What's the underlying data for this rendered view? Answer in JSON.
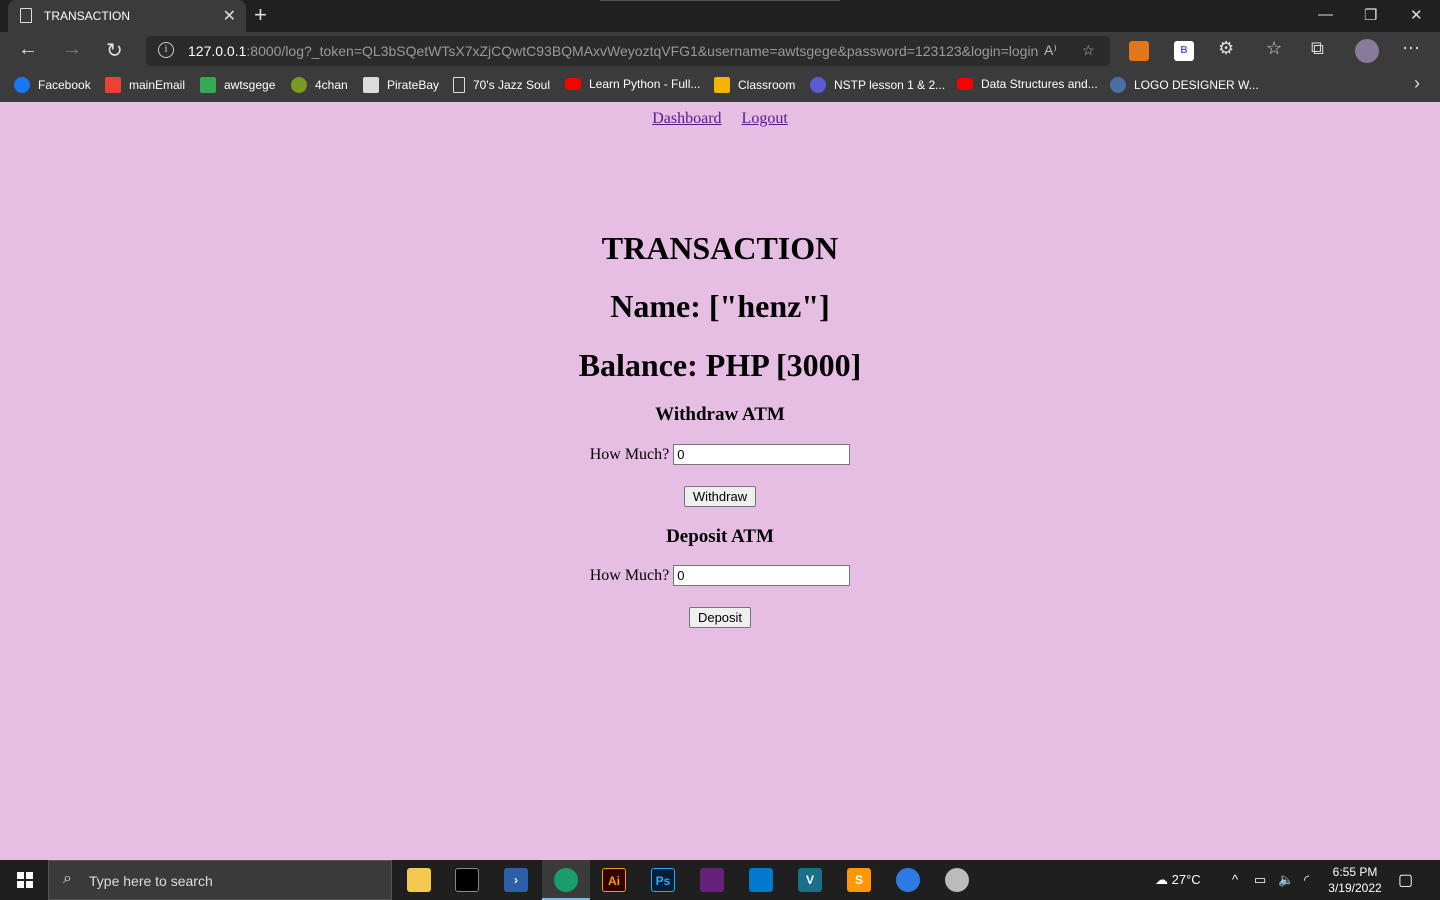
{
  "browser": {
    "tab_title": "TRANSACTION",
    "url_host": "127.0.0.1",
    "url_rest": ":8000/log?_token=QL3bSQetWTsX7xZjCQwtC93BQMAxvWeyoztqVFG1&username=awtsgege&password=123123&login=login",
    "bookmarks": [
      {
        "label": "Facebook",
        "icon": "facebook-icon",
        "color": "#1877f2"
      },
      {
        "label": "mainEmail",
        "icon": "gmail-icon",
        "color": "#ea4335"
      },
      {
        "label": "awtsgege",
        "icon": "drive-icon",
        "color": "#34a853"
      },
      {
        "label": "4chan",
        "icon": "clover-icon",
        "color": "#789922"
      },
      {
        "label": "PirateBay",
        "icon": "pirate-icon",
        "color": "#dddddd"
      },
      {
        "label": "70's Jazz Soul",
        "icon": "page-icon",
        "color": "#dddddd"
      },
      {
        "label": "Learn Python - Full...",
        "icon": "youtube-icon",
        "color": "#ff0000"
      },
      {
        "label": "Classroom",
        "icon": "classroom-icon",
        "color": "#f4b400"
      },
      {
        "label": "NSTP lesson 1 & 2...",
        "icon": "globe-icon",
        "color": "#5b5bd6"
      },
      {
        "label": "Data Structures and...",
        "icon": "youtube-icon",
        "color": "#ff0000"
      },
      {
        "label": "LOGO DESIGNER W...",
        "icon": "logo-icon",
        "color": "#4a6fa5"
      }
    ]
  },
  "page": {
    "nav": {
      "dashboard": "Dashboard",
      "logout": "Logout"
    },
    "title": "TRANSACTION",
    "name_line": "Name: [\"henz\"]",
    "balance_line": "Balance: PHP [3000]",
    "withdraw": {
      "heading": "Withdraw ATM",
      "label": "How Much?",
      "value": "0",
      "button": "Withdraw"
    },
    "deposit": {
      "heading": "Deposit ATM",
      "label": "How Much?",
      "value": "0",
      "button": "Deposit"
    }
  },
  "taskbar": {
    "search_placeholder": "Type here to search",
    "weather": "27°C",
    "time": "6:55 PM",
    "date": "3/19/2022"
  }
}
